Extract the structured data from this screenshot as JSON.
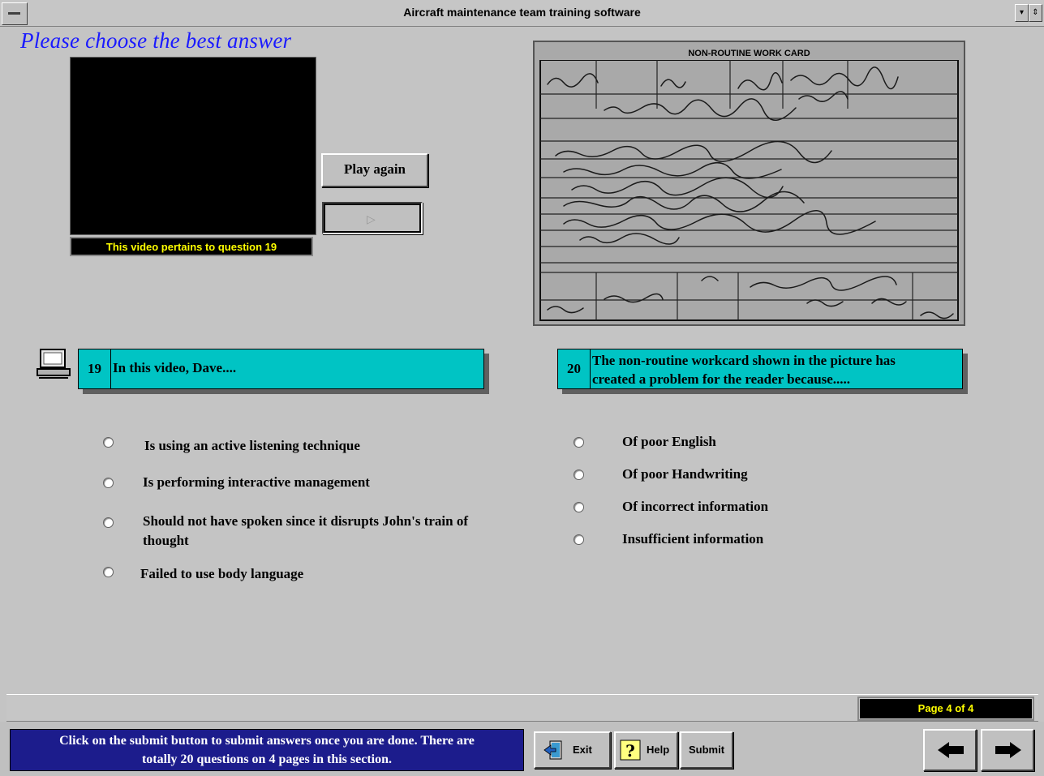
{
  "window": {
    "title": "Aircraft maintenance team training software",
    "min_glyph": "▾",
    "max_glyph": "⇕"
  },
  "prompt": "Please choose the best answer",
  "video": {
    "caption": "This video pertains to question 19",
    "play_again_label": "Play again",
    "play_glyph": "▷"
  },
  "workcard": {
    "title": "NON-ROUTINE WORK CARD"
  },
  "questions": [
    {
      "number": "19",
      "text": "In this video, Dave....",
      "options": [
        "Is using an active listening technique",
        "Is performing interactive management",
        "Should not have spoken since it disrupts John's train of thought",
        "Failed to use body language"
      ]
    },
    {
      "number": "20",
      "text_line1": "The non-routine workcard shown in the picture has",
      "text_line2": "created a problem for the reader because.....",
      "options": [
        "Of poor English",
        "Of poor Handwriting",
        "Of incorrect information",
        "Insufficient information"
      ]
    }
  ],
  "status": {
    "page_indicator": "Page 4 of 4"
  },
  "footer": {
    "instructions_line1": "Click on the submit button to submit answers once you are done. There are",
    "instructions_line2": "totally 20 questions on 4 pages in this section.",
    "exit_label": "Exit",
    "help_label": "Help",
    "submit_label": "Submit"
  },
  "icons": {
    "computer": "computer-icon",
    "exit": "exit-door-icon",
    "help": "question-mark-icon",
    "prev": "arrow-left-icon",
    "next": "arrow-right-icon"
  }
}
